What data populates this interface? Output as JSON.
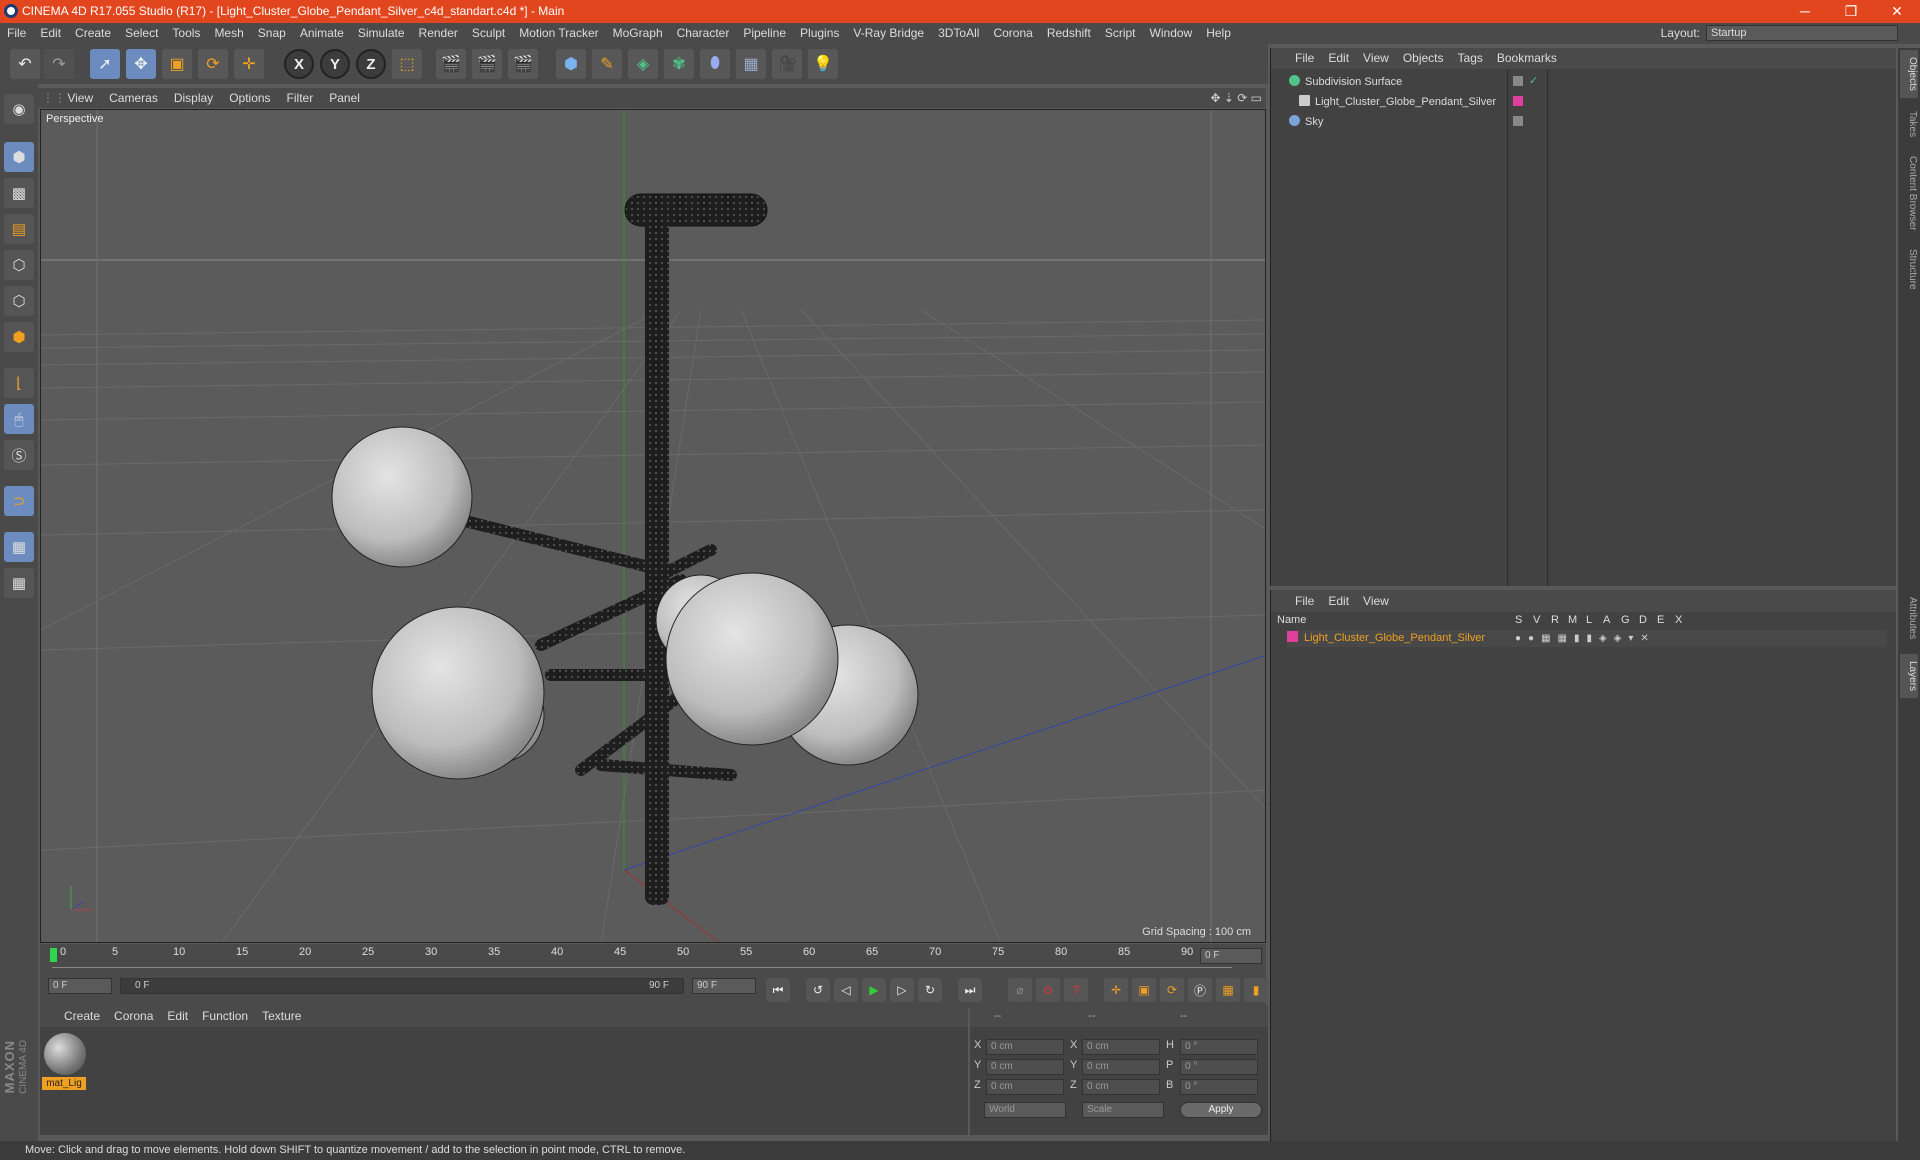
{
  "window": {
    "title": "CINEMA 4D R17.055 Studio (R17) - [Light_Cluster_Globe_Pendant_Silver_c4d_standart.c4d *] - Main",
    "controls": [
      "─",
      "❐",
      "✕"
    ]
  },
  "menubar": {
    "items": [
      "File",
      "Edit",
      "Create",
      "Select",
      "Tools",
      "Mesh",
      "Snap",
      "Animate",
      "Simulate",
      "Render",
      "Sculpt",
      "Motion Tracker",
      "MoGraph",
      "Character",
      "Pipeline",
      "Plugins",
      "V-Ray Bridge",
      "3DToAll",
      "Corona",
      "Redshift",
      "Script",
      "Window",
      "Help"
    ],
    "layout_label": "Layout:",
    "layout_value": "Startup"
  },
  "viewport": {
    "menu": [
      "View",
      "Cameras",
      "Display",
      "Options",
      "Filter",
      "Panel"
    ],
    "label": "Perspective",
    "grid_spacing": "Grid Spacing : 100 cm"
  },
  "timeline": {
    "ticks": [
      "0",
      "5",
      "10",
      "15",
      "20",
      "25",
      "30",
      "35",
      "40",
      "45",
      "50",
      "55",
      "60",
      "65",
      "70",
      "75",
      "80",
      "85",
      "90"
    ],
    "current_frame": "0 F",
    "start_field": "0 F",
    "range_start": "0 F",
    "range_end": "90 F",
    "end_field": "90 F"
  },
  "material_manager": {
    "menu": [
      "Create",
      "Corona",
      "Edit",
      "Function",
      "Texture"
    ],
    "materials": [
      {
        "name": "mat_Lig"
      }
    ]
  },
  "coordinates": {
    "headers": [
      "--",
      "--",
      "--"
    ],
    "rows": [
      {
        "axis": "X",
        "pos": "0 cm",
        "axis2": "X",
        "size": "0 cm",
        "axis3": "H",
        "rot": "0 °"
      },
      {
        "axis": "Y",
        "pos": "0 cm",
        "axis2": "Y",
        "size": "0 cm",
        "axis3": "P",
        "rot": "0 °"
      },
      {
        "axis": "Z",
        "pos": "0 cm",
        "axis2": "Z",
        "size": "0 cm",
        "axis3": "B",
        "rot": "0 °"
      }
    ],
    "mode": "World",
    "transform": "Scale",
    "apply_label": "Apply"
  },
  "object_manager": {
    "menu": [
      "File",
      "Edit",
      "View",
      "Objects",
      "Tags",
      "Bookmarks"
    ],
    "objects": [
      {
        "name": "Subdivision Surface",
        "color": "#4fc38a"
      },
      {
        "name": "Light_Cluster_Globe_Pendant_Silver",
        "color": "#cccccc"
      },
      {
        "name": "Sky",
        "color": "#7aa4d8"
      }
    ]
  },
  "layer_manager": {
    "menu": [
      "File",
      "Edit",
      "View"
    ],
    "columns": [
      "Name",
      "S",
      "V",
      "R",
      "M",
      "L",
      "A",
      "G",
      "D",
      "E",
      "X"
    ],
    "layers": [
      {
        "name": "Light_Cluster_Globe_Pendant_Silver",
        "color": "#e0409a"
      }
    ]
  },
  "right_tabs": [
    "Objects",
    "Takes",
    "Content Browser",
    "Structure",
    "Attributes",
    "Layers"
  ],
  "status": "Move: Click and drag to move elements. Hold down SHIFT to quantize movement / add to the selection in point mode, CTRL to remove.",
  "logo": {
    "brand": "MAXON",
    "product": "CINEMA 4D"
  },
  "colors": {
    "title_bar": "#e2461e",
    "accent": "#6c8cbf",
    "material_label": "#f0a020",
    "layer_name": "#f0a020"
  }
}
